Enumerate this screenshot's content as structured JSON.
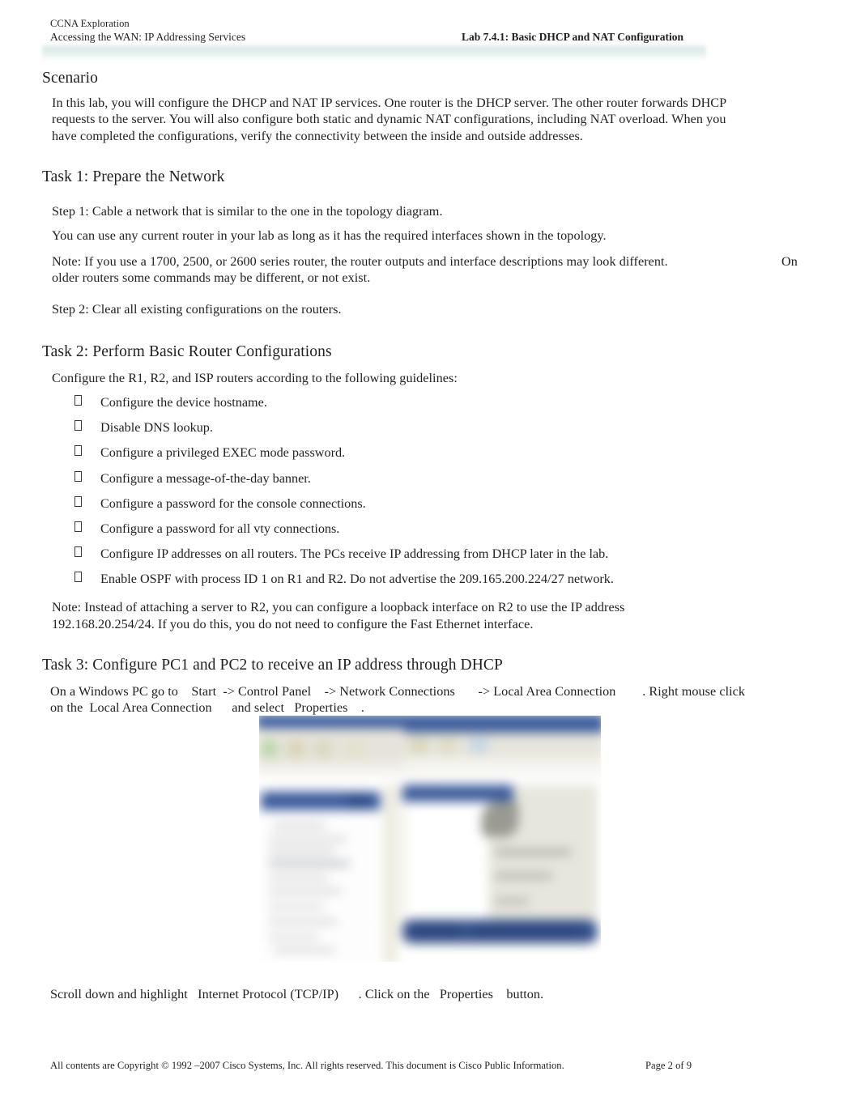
{
  "document": {
    "header": {
      "course": "CCNA Exploration",
      "subtitle": "Accessing the WAN: IP Addressing Services",
      "lab_title": "Lab 7.4.1: Basic DHCP and NAT Configuration"
    },
    "scenario": {
      "heading": "Scenario",
      "body": "In this lab, you will configure the DHCP and NAT IP services. One router is the DHCP server. The other router forwards DHCP requests to the server. You will also configure both static and dynamic NAT configurations, including NAT overload. When you have completed the configurations, verify the connectivity between the inside and outside addresses."
    },
    "task1": {
      "heading": "Task 1: Prepare the Network",
      "step1": "Step 1: Cable a network that is similar to the one in the topology diagram.",
      "step1_body": "You can use any current router in your lab as long as it has the required interfaces shown in the topology.",
      "note": "Note: If you use a 1700, 2500, or 2600 series router, the router outputs and interface descriptions may look different.",
      "note_overflow": "On",
      "note_line2": "older routers some commands may be different, or not exist.",
      "step2": "Step 2: Clear all existing configurations on the routers."
    },
    "task2": {
      "heading": "Task 2: Perform Basic Router Configurations",
      "intro": "Configure the R1, R2, and ISP routers according to the following guidelines:",
      "bullet_glyph": "missing-glyph-box",
      "bullets": [
        "Configure the device hostname.",
        "Disable DNS lookup.",
        "Configure a privileged EXEC mode password.",
        "Configure a message-of-the-day banner.",
        "Configure a password for the console connections.",
        "Configure a password for all vty connections.",
        "Configure IP addresses on all routers. The PCs receive IP addressing from DHCP later in the lab.",
        "Enable OSPF with process ID 1 on R1 and R2. Do not advertise the 209.165.200.224/27 network."
      ],
      "note_line1": "Note: Instead of attaching a server to R2, you can configure a loopback interface on R2 to use the IP address",
      "note_line2": "192.168.20.254/24. If you do this, you do not need to configure the Fast Ethernet interface."
    },
    "task3": {
      "heading": "Task 3:    Configure PC1 and PC2 to receive an IP address through DHCP",
      "instruction_line1_segments": [
        "On a Windows PC go to",
        "Start",
        "->",
        "Control Panel",
        "-> Network Connections",
        "-> Local Area Connection",
        ". Right mouse click"
      ],
      "instruction_line1": "On a Windows PC go to    Start  -> Control Panel    -> Network Connections       -> Local Area Connection        . Right mouse click",
      "instruction_line2": "on the  Local Area Connection      and select   Properties    .",
      "screenshot_alt": "Blurred Windows XP Network Connections and Local Area Connection Properties dialog screenshot",
      "caption": "Scroll down and highlight   Internet Protocol (TCP/IP)      . Click on the   Properties    button."
    },
    "footer": {
      "copyright": "All contents are Copyright © 1992   –2007 Cisco Systems, Inc. All rights reserved. This document is Cisco Public Information.",
      "page": "Page 2 of 9"
    },
    "colors": {
      "text": "#231f20",
      "header_band": "#dfebeb",
      "dialog_titlebar": "#3c5c9c",
      "page_background": "#ffffff"
    }
  }
}
